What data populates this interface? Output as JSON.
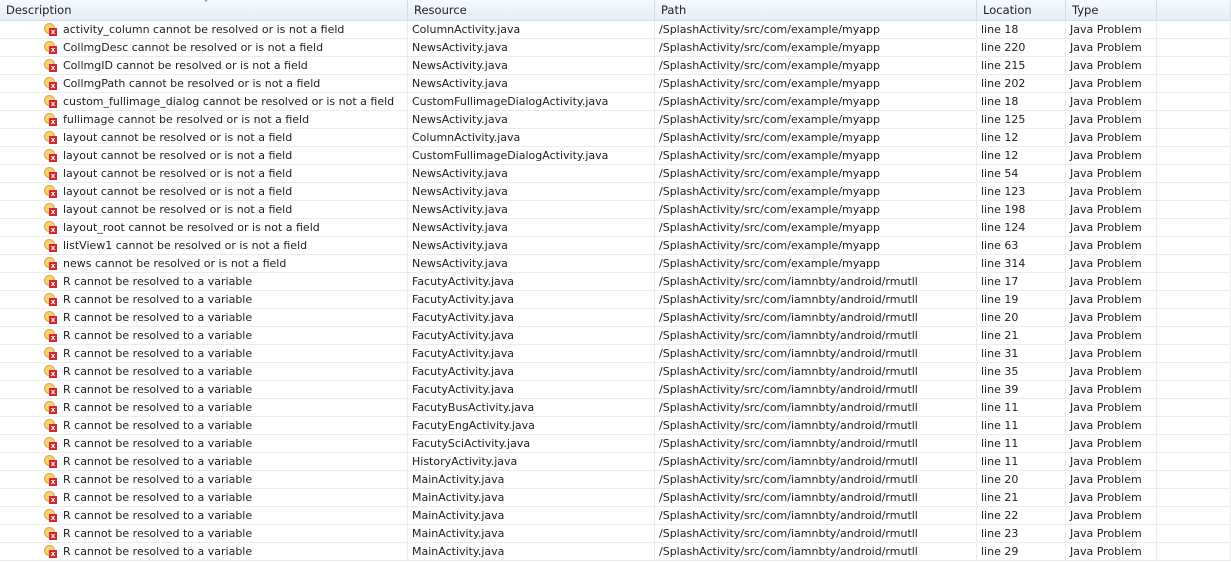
{
  "columns": [
    "Description",
    "Resource",
    "Path",
    "Location",
    "Type"
  ],
  "rows": [
    [
      "activity_column cannot be resolved or is not a field",
      "ColumnActivity.java",
      "/SplashActivity/src/com/example/myapp",
      "line 18",
      "Java Problem"
    ],
    [
      "CollmgDesc cannot be resolved or is not a field",
      "NewsActivity.java",
      "/SplashActivity/src/com/example/myapp",
      "line 220",
      "Java Problem"
    ],
    [
      "CollmgID cannot be resolved or is not a field",
      "NewsActivity.java",
      "/SplashActivity/src/com/example/myapp",
      "line 215",
      "Java Problem"
    ],
    [
      "CollmgPath cannot be resolved or is not a field",
      "NewsActivity.java",
      "/SplashActivity/src/com/example/myapp",
      "line 202",
      "Java Problem"
    ],
    [
      "custom_fullimage_dialog cannot be resolved or is not a field",
      "CustomFullimageDialogActivity.java",
      "/SplashActivity/src/com/example/myapp",
      "line 18",
      "Java Problem"
    ],
    [
      "fullimage cannot be resolved or is not a field",
      "NewsActivity.java",
      "/SplashActivity/src/com/example/myapp",
      "line 125",
      "Java Problem"
    ],
    [
      "layout cannot be resolved or is not a field",
      "ColumnActivity.java",
      "/SplashActivity/src/com/example/myapp",
      "line 12",
      "Java Problem"
    ],
    [
      "layout cannot be resolved or is not a field",
      "CustomFullimageDialogActivity.java",
      "/SplashActivity/src/com/example/myapp",
      "line 12",
      "Java Problem"
    ],
    [
      "layout cannot be resolved or is not a field",
      "NewsActivity.java",
      "/SplashActivity/src/com/example/myapp",
      "line 54",
      "Java Problem"
    ],
    [
      "layout cannot be resolved or is not a field",
      "NewsActivity.java",
      "/SplashActivity/src/com/example/myapp",
      "line 123",
      "Java Problem"
    ],
    [
      "layout cannot be resolved or is not a field",
      "NewsActivity.java",
      "/SplashActivity/src/com/example/myapp",
      "line 198",
      "Java Problem"
    ],
    [
      "layout_root cannot be resolved or is not a field",
      "NewsActivity.java",
      "/SplashActivity/src/com/example/myapp",
      "line 124",
      "Java Problem"
    ],
    [
      "listView1 cannot be resolved or is not a field",
      "NewsActivity.java",
      "/SplashActivity/src/com/example/myapp",
      "line 63",
      "Java Problem"
    ],
    [
      "news cannot be resolved or is not a field",
      "NewsActivity.java",
      "/SplashActivity/src/com/example/myapp",
      "line 314",
      "Java Problem"
    ],
    [
      "R cannot be resolved to a variable",
      "FacutyActivity.java",
      "/SplashActivity/src/com/iamnbty/android/rmutll",
      "line 17",
      "Java Problem"
    ],
    [
      "R cannot be resolved to a variable",
      "FacutyActivity.java",
      "/SplashActivity/src/com/iamnbty/android/rmutll",
      "line 19",
      "Java Problem"
    ],
    [
      "R cannot be resolved to a variable",
      "FacutyActivity.java",
      "/SplashActivity/src/com/iamnbty/android/rmutll",
      "line 20",
      "Java Problem"
    ],
    [
      "R cannot be resolved to a variable",
      "FacutyActivity.java",
      "/SplashActivity/src/com/iamnbty/android/rmutll",
      "line 21",
      "Java Problem"
    ],
    [
      "R cannot be resolved to a variable",
      "FacutyActivity.java",
      "/SplashActivity/src/com/iamnbty/android/rmutll",
      "line 31",
      "Java Problem"
    ],
    [
      "R cannot be resolved to a variable",
      "FacutyActivity.java",
      "/SplashActivity/src/com/iamnbty/android/rmutll",
      "line 35",
      "Java Problem"
    ],
    [
      "R cannot be resolved to a variable",
      "FacutyActivity.java",
      "/SplashActivity/src/com/iamnbty/android/rmutll",
      "line 39",
      "Java Problem"
    ],
    [
      "R cannot be resolved to a variable",
      "FacutyBusActivity.java",
      "/SplashActivity/src/com/iamnbty/android/rmutll",
      "line 11",
      "Java Problem"
    ],
    [
      "R cannot be resolved to a variable",
      "FacutyEngActivity.java",
      "/SplashActivity/src/com/iamnbty/android/rmutll",
      "line 11",
      "Java Problem"
    ],
    [
      "R cannot be resolved to a variable",
      "FacutySciActivity.java",
      "/SplashActivity/src/com/iamnbty/android/rmutll",
      "line 11",
      "Java Problem"
    ],
    [
      "R cannot be resolved to a variable",
      "HistoryActivity.java",
      "/SplashActivity/src/com/iamnbty/android/rmutll",
      "line 11",
      "Java Problem"
    ],
    [
      "R cannot be resolved to a variable",
      "MainActivity.java",
      "/SplashActivity/src/com/iamnbty/android/rmutll",
      "line 20",
      "Java Problem"
    ],
    [
      "R cannot be resolved to a variable",
      "MainActivity.java",
      "/SplashActivity/src/com/iamnbty/android/rmutll",
      "line 21",
      "Java Problem"
    ],
    [
      "R cannot be resolved to a variable",
      "MainActivity.java",
      "/SplashActivity/src/com/iamnbty/android/rmutll",
      "line 22",
      "Java Problem"
    ],
    [
      "R cannot be resolved to a variable",
      "MainActivity.java",
      "/SplashActivity/src/com/iamnbty/android/rmutll",
      "line 23",
      "Java Problem"
    ],
    [
      "R cannot be resolved to a variable",
      "MainActivity.java",
      "/SplashActivity/src/com/iamnbty/android/rmutll",
      "line 29",
      "Java Problem"
    ]
  ]
}
